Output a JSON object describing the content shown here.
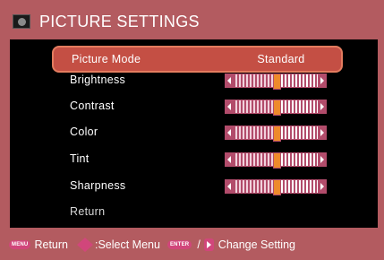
{
  "header": {
    "icon": "picture-icon",
    "title": "PICTURE SETTINGS"
  },
  "menu": {
    "items": [
      {
        "label": "Picture Mode",
        "value": "Standard",
        "type": "select",
        "selected": true
      },
      {
        "label": "Brightness",
        "type": "slider",
        "level": 0.5
      },
      {
        "label": "Contrast",
        "type": "slider",
        "level": 0.5
      },
      {
        "label": "Color",
        "type": "slider",
        "level": 0.5
      },
      {
        "label": "Tint",
        "type": "slider",
        "level": 0.5
      },
      {
        "label": "Sharpness",
        "type": "slider",
        "level": 0.5
      },
      {
        "label": "Return",
        "type": "action"
      }
    ]
  },
  "footer": {
    "menu_key": "MENU",
    "return_label": "Return",
    "select_label": ":Select Menu",
    "enter_key": "ENTER",
    "slash": "/",
    "change_label": "Change Setting"
  },
  "colors": {
    "background": "#b35b60",
    "panel": "#000000",
    "highlight": "#c44f44",
    "accent": "#d1467b",
    "thumb": "#ee8a2b"
  }
}
